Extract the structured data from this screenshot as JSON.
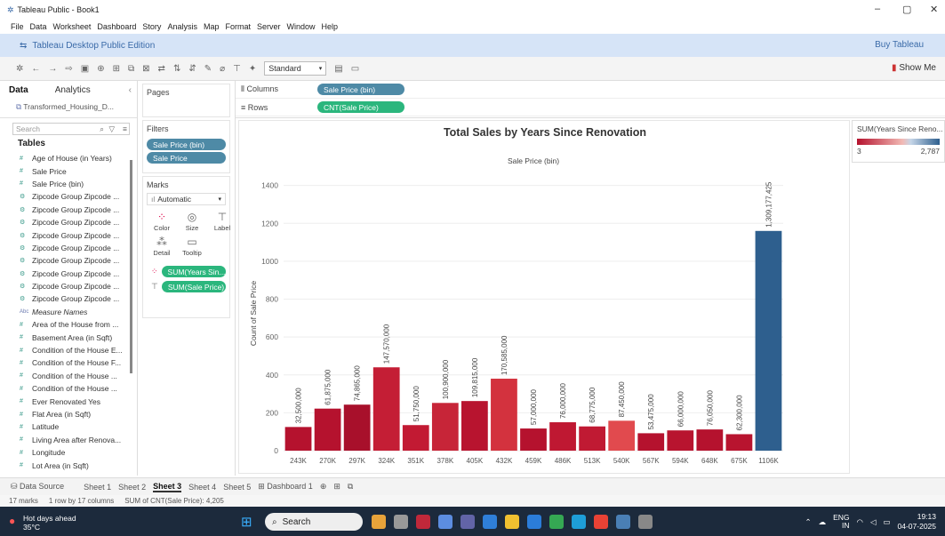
{
  "window": {
    "title": "Tableau Public - Book1",
    "controls": [
      "–",
      "▢",
      "✕"
    ]
  },
  "menu": [
    "File",
    "Data",
    "Worksheet",
    "Dashboard",
    "Story",
    "Analysis",
    "Map",
    "Format",
    "Server",
    "Window",
    "Help"
  ],
  "banner": {
    "edition": "Tableau Desktop Public Edition",
    "buy": "Buy Tableau"
  },
  "toolbar": {
    "fit": "Standard",
    "show_me": "Show Me"
  },
  "left": {
    "tabs": [
      "Data",
      "Analytics"
    ],
    "datasource": "Transformed_Housing_D...",
    "search_placeholder": "Search",
    "tables_label": "Tables",
    "fields": [
      "Age of House (in Years)",
      "Sale Price",
      "Sale Price (bin)",
      "Zipcode Group Zipcode ...",
      "Zipcode Group Zipcode ...",
      "Zipcode Group Zipcode ...",
      "Zipcode Group Zipcode ...",
      "Zipcode Group Zipcode ...",
      "Zipcode Group Zipcode ...",
      "Zipcode Group Zipcode ...",
      "Zipcode Group Zipcode ...",
      "Zipcode Group Zipcode ...",
      "Measure Names",
      "Area of the House from ...",
      "Basement Area (in Sqft)",
      "Condition of the House E...",
      "Condition of the House F...",
      "Condition of the House ...",
      "Condition of the House ...",
      "Ever Renovated Yes",
      "Flat Area (in Sqft)",
      "Latitude",
      "Living Area after Renova...",
      "Longitude",
      "Lot Area (in Sqft)"
    ]
  },
  "cards": {
    "pages": "Pages",
    "filters": "Filters",
    "filter_pills": [
      "Sale Price (bin)",
      "Sale Price"
    ],
    "marks": "Marks",
    "mark_type": "Automatic",
    "mark_buttons": [
      "Color",
      "Size",
      "Label",
      "Detail",
      "Tooltip"
    ],
    "mark_pills": [
      "SUM(Years Sin...",
      "SUM(Sale Price)"
    ]
  },
  "shelves": {
    "columns_label": "Columns",
    "columns_pill": "Sale Price (bin)",
    "rows_label": "Rows",
    "rows_pill": "CNT(Sale Price)"
  },
  "legend": {
    "title": "SUM(Years Since Reno...",
    "min": "3",
    "max": "2,787"
  },
  "chart_data": {
    "type": "bar",
    "title": "Total Sales by Years Since Renovation",
    "xlabel": "Sale Price (bin)",
    "ylabel": "Count of Sale Price",
    "ylim": [
      0,
      1450
    ],
    "yticks": [
      0,
      200,
      400,
      600,
      800,
      1000,
      1200,
      1400
    ],
    "categories": [
      "243K",
      "270K",
      "297K",
      "324K",
      "351K",
      "378K",
      "405K",
      "432K",
      "459K",
      "486K",
      "513K",
      "540K",
      "567K",
      "594K",
      "648K",
      "675K",
      "1106K"
    ],
    "values": [
      125,
      222,
      243,
      440,
      135,
      252,
      262,
      380,
      117,
      150,
      128,
      158,
      92,
      107,
      112,
      87,
      1160
    ],
    "labels": [
      "32,500,000",
      "61,875,000",
      "74,865,000",
      "147,570,000",
      "51,750,000",
      "100,900,000",
      "109,815,000",
      "170,585,000",
      "57,000,000",
      "76,000,000",
      "68,775,000",
      "87,450,000",
      "53,475,000",
      "66,000,000",
      "76,050,000",
      "62,300,000",
      "1,309,177,425"
    ],
    "colors": [
      "#b5122e",
      "#b5122e",
      "#a8102b",
      "#c41e35",
      "#c21a33",
      "#c72538",
      "#b8142f",
      "#d3323e",
      "#b5122e",
      "#bf1832",
      "#c01a33",
      "#e14a4e",
      "#b5122e",
      "#b8142f",
      "#b5122e",
      "#b8142f",
      "#2e5f8e"
    ]
  },
  "sheet_tabs": [
    "Data Source",
    "Sheet 1",
    "Sheet 2",
    "Sheet 3",
    "Sheet 4",
    "Sheet 5",
    "Dashboard 1"
  ],
  "active_sheet": "Sheet 3",
  "status": [
    "17 marks",
    "1 row by 17 columns",
    "SUM of CNT(Sale Price): 4,205"
  ],
  "taskbar": {
    "weather_title": "Hot days ahead",
    "weather_temp": "35°C",
    "search": "Search",
    "lang": "ENG",
    "region": "IN",
    "time": "19:13",
    "date": "04-07-2025"
  }
}
